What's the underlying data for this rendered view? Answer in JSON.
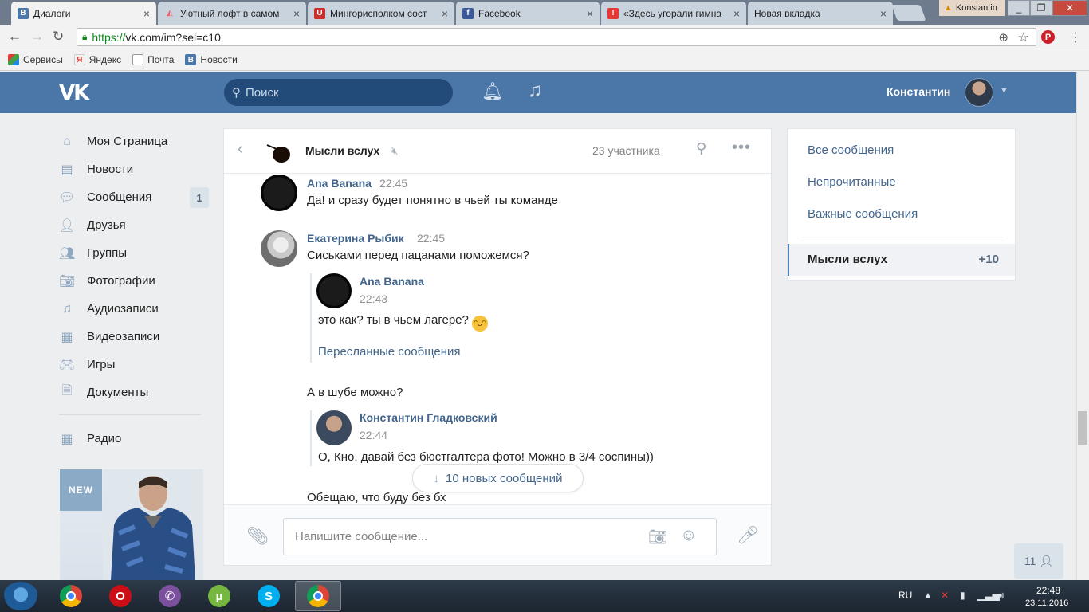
{
  "browser": {
    "tabs": [
      {
        "title": "Диалоги",
        "favicon": "vk-icon",
        "color": "#4a76a8",
        "active": true
      },
      {
        "title": "Уютный лофт в самом",
        "favicon": "airbnb-icon",
        "color": "#ff5a5f"
      },
      {
        "title": "Мингорисполком сост",
        "favicon": "shield-icon",
        "color": "#c9302c"
      },
      {
        "title": "Facebook",
        "favicon": "facebook-icon",
        "color": "#3b5998"
      },
      {
        "title": "«Здесь угорали гимна",
        "favicon": "news-icon",
        "color": "#e53935"
      },
      {
        "title": "Новая вкладка",
        "favicon": "none",
        "color": "#c9d3de"
      }
    ],
    "profile_name": "Konstantin",
    "url_scheme": "https://",
    "url_rest": "vk.com/im?sel=c10",
    "bookmarks": [
      {
        "label": "Сервисы",
        "icon": "apps-icon"
      },
      {
        "label": "Яндекс",
        "icon": "yandex-icon"
      },
      {
        "label": "Почта",
        "icon": "page-icon"
      },
      {
        "label": "Новости",
        "icon": "vk-icon"
      }
    ]
  },
  "vk": {
    "logo": "VK",
    "search_placeholder": "Поиск",
    "user_name": "Константин",
    "accent": "#4a76a8",
    "nav": [
      {
        "label": "Моя Страница",
        "icon": "home-icon"
      },
      {
        "label": "Новости",
        "icon": "news-icon"
      },
      {
        "label": "Сообщения",
        "icon": "chat-icon",
        "count": "1"
      },
      {
        "label": "Друзья",
        "icon": "user-icon"
      },
      {
        "label": "Группы",
        "icon": "group-icon"
      },
      {
        "label": "Фотографии",
        "icon": "camera-icon"
      },
      {
        "label": "Аудиозаписи",
        "icon": "music-icon"
      },
      {
        "label": "Видеозаписи",
        "icon": "film-icon"
      },
      {
        "label": "Игры",
        "icon": "gamepad-icon"
      },
      {
        "label": "Документы",
        "icon": "document-icon"
      }
    ],
    "nav_extra": {
      "label": "Радио",
      "icon": "grid-icon"
    },
    "ad_badge": "NEW"
  },
  "chat": {
    "title": "Мысли вслух",
    "participants": "23 участника",
    "messages": {
      "m1_author": "Ana Banana",
      "m1_time": "22:45",
      "m1_text": "Да! и сразу будет понятно в чьей ты команде",
      "m2_author": "Екатерина Рыбик",
      "m2_time": "22:45",
      "m2_text": "Сиськами перед пацанами поможемся?",
      "fwd1_author": "Ana Banana",
      "fwd1_time": "22:43",
      "fwd1_text": "это как? ты в чьем лагере?",
      "fwd_link": "Пересланные сообщения",
      "m3_text": "А в шубе можно?",
      "fwd2_author": "Константин Гладковский",
      "fwd2_time": "22:44",
      "fwd2_text": "О, Кно, давай без бюстгалтера фото! Можно в 3/4 соспины))",
      "m4_text": "Обещаю, что буду без бх"
    },
    "new_messages": "10 новых сообщений",
    "input_placeholder": "Напишите сообщение..."
  },
  "filters": {
    "all": "Все сообщения",
    "unread": "Непрочитанные",
    "important": "Важные сообщения",
    "conversation": "Мысли вслух",
    "conversation_count": "+10"
  },
  "online_count": "11",
  "taskbar": {
    "apps": [
      {
        "name": "chrome-icon",
        "color": "#db4437"
      },
      {
        "name": "opera-icon",
        "color": "#cc0f16"
      },
      {
        "name": "viber-icon",
        "color": "#7b519d"
      },
      {
        "name": "utorrent-icon",
        "color": "#76b83f"
      },
      {
        "name": "skype-icon",
        "color": "#00aff0"
      },
      {
        "name": "chrome-icon",
        "color": "#db4437",
        "active": true
      }
    ],
    "lang": "RU",
    "time": "22:48",
    "date": "23.11.2016"
  }
}
